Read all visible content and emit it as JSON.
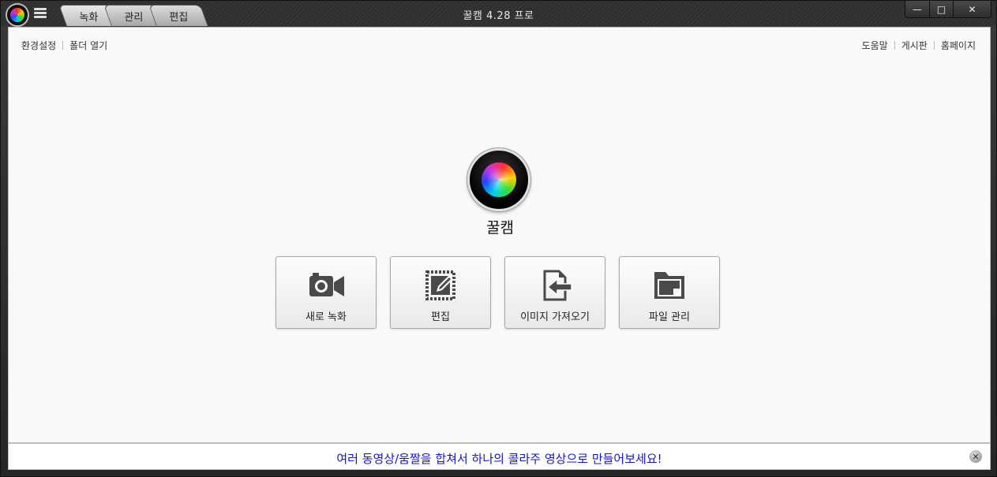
{
  "window": {
    "title": "꿀캠 4.28 프로",
    "controls": {
      "minimize": "—",
      "maximize": "□",
      "close": "✕"
    }
  },
  "tabs": [
    {
      "label": "녹화"
    },
    {
      "label": "관리"
    },
    {
      "label": "편집"
    }
  ],
  "top_links_left": [
    {
      "label": "환경설정"
    },
    {
      "label": "폴더 열기"
    }
  ],
  "top_links_right": [
    {
      "label": "도움말"
    },
    {
      "label": "게시판"
    },
    {
      "label": "홈페이지"
    }
  ],
  "logo": {
    "name": "꿀캠",
    "icon": "camera-lens-icon"
  },
  "actions": [
    {
      "label": "새로 녹화",
      "icon": "video-camera-icon"
    },
    {
      "label": "편집",
      "icon": "edit-icon"
    },
    {
      "label": "이미지 가져오기",
      "icon": "import-image-icon"
    },
    {
      "label": "파일 관리",
      "icon": "file-folder-icon"
    }
  ],
  "banner": {
    "text": "여러 동영상/움짤을 합쳐서 하나의 콜라주 영상으로 만들어보세요!",
    "close": "✕",
    "color": "#1515c8"
  },
  "colors": {
    "icon": "#4a4a4a",
    "title_bar": "#2e2e2e",
    "content_bg": "#fafafa"
  }
}
